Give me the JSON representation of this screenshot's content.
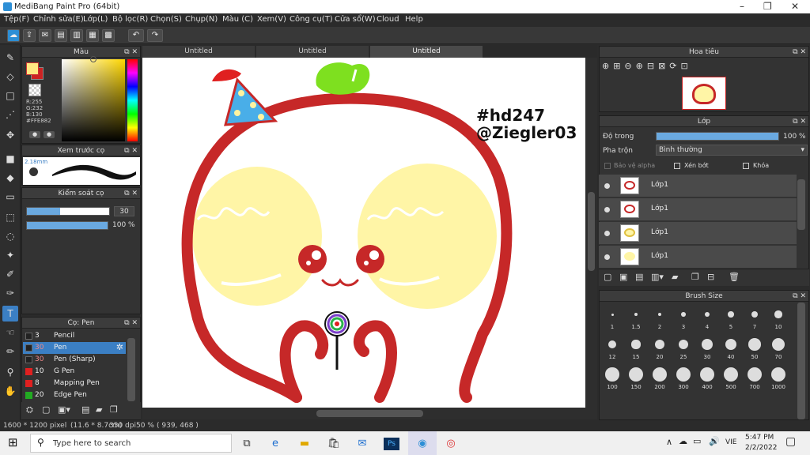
{
  "window": {
    "title": "MediBang Paint Pro (64bit)",
    "controls": [
      "–",
      "❐",
      "✕"
    ]
  },
  "menu": [
    "Tệp(F)",
    "Chỉnh sửa(E)",
    "Lớp(L)",
    "Bộ lọc(R)",
    "Chọn(S)",
    "Chụp(N)",
    "Màu (C)",
    "Xem(V)",
    "Công cụ(T)",
    "Cửa sổ(W)",
    "Cloud",
    "Help"
  ],
  "tabs": [
    "Untitled",
    "Untitled",
    "Untitled"
  ],
  "color_panel": {
    "title": "Màu",
    "r": "R:255",
    "g": "G:232",
    "b": "B:130",
    "hex": "#FFE882",
    "fg_color": "#FFE882",
    "bg_color": "#cc2222"
  },
  "brush_preview": {
    "title": "Xem trước cọ",
    "size": "2.18mm"
  },
  "brush_control": {
    "title": "Kiểm soát cọ",
    "size_value": "30",
    "opacity_value": "100 %",
    "size_fraction": 0.4,
    "opacity_fraction": 1.0
  },
  "brush_list": {
    "title": "Cọ: Pen",
    "items": [
      {
        "num": "3",
        "name": "Pencil",
        "color": "#222222"
      },
      {
        "num": "30",
        "name": "Pen",
        "color": "#222222"
      },
      {
        "num": "30",
        "name": "Pen (Sharp)",
        "color": "#222222"
      },
      {
        "num": "10",
        "name": "G Pen",
        "color": "#e02020"
      },
      {
        "num": "8",
        "name": "Mapping Pen",
        "color": "#e02020"
      },
      {
        "num": "20",
        "name": "Edge Pen",
        "color": "#22aa22"
      }
    ]
  },
  "canvas": {
    "text1": "#hd247",
    "text2": "@Ziegler03"
  },
  "navigator": {
    "title": "Hoa tiêu"
  },
  "layer_panel": {
    "title": "Lớp",
    "opacity_label": "Độ trong",
    "opacity_value": "100 %",
    "opacity_fraction": 1.0,
    "blend_label": "Pha trộn",
    "blend_value": "Bình thường",
    "protect_alpha": "Bảo vệ alpha",
    "clipping": "Xén bớt",
    "lock": "Khóa",
    "layers": [
      "Lớp1",
      "Lớp1",
      "Lớp1",
      "Lớp1"
    ]
  },
  "brush_size": {
    "title": "Brush Size",
    "sizes": [
      "1",
      "1.5",
      "2",
      "3",
      "4",
      "5",
      "7",
      "10",
      "12",
      "15",
      "20",
      "25",
      "30",
      "40",
      "50",
      "70",
      "100",
      "150",
      "200",
      "300",
      "400",
      "500",
      "700",
      "1000"
    ]
  },
  "status": {
    "dimensions": "1600 * 1200 pixel",
    "physical": "(11.6 * 8.7cm)",
    "dpi": "350 dpi",
    "zoom": "50 %",
    "cursor": "( 939, 468 )"
  },
  "taskbar": {
    "search_placeholder": "Type here to search",
    "time": "5:47 PM",
    "date": "2/2/2022",
    "lang": "VIE"
  }
}
